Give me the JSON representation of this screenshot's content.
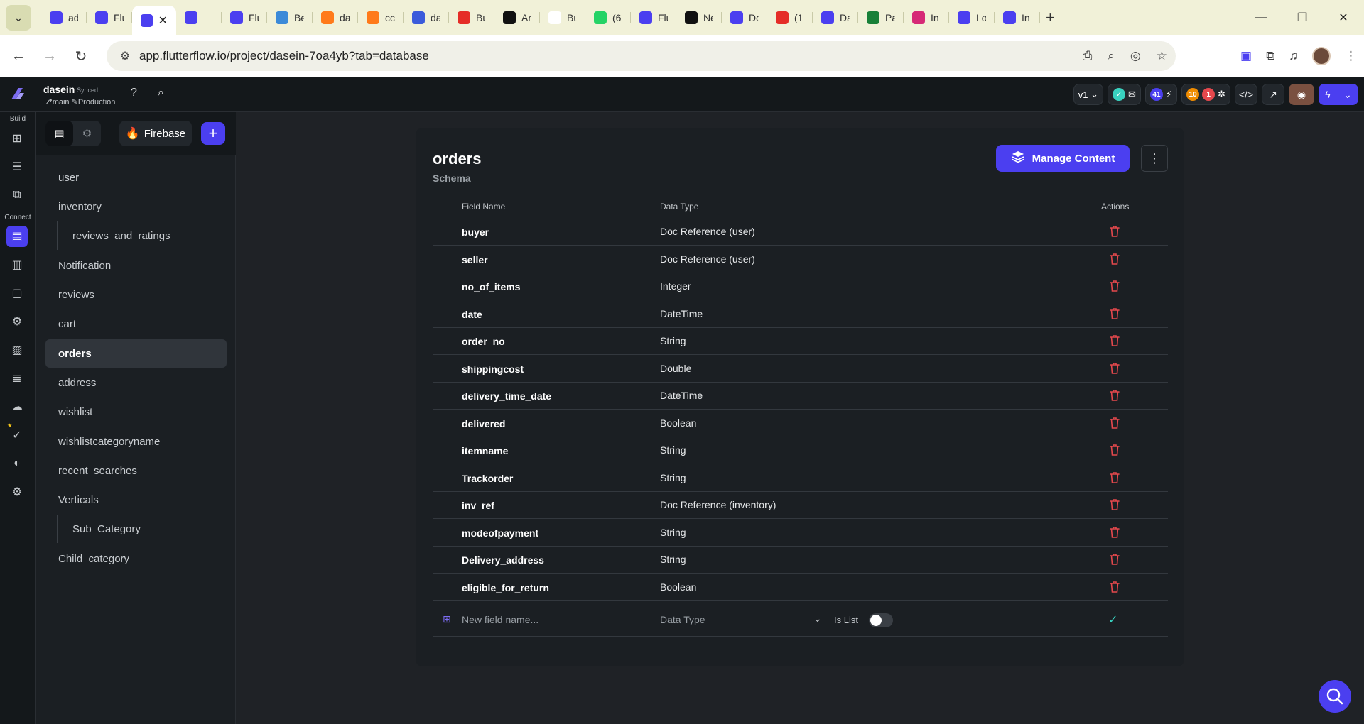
{
  "browser": {
    "tabs": [
      {
        "icon": "flutterflow-icon",
        "title": "ad",
        "color": "#4b3ff0"
      },
      {
        "icon": "flutterflow-icon",
        "title": "Flu",
        "color": "#4b3ff0"
      },
      {
        "icon": "flutterflow-icon",
        "title": "",
        "color": "#4b3ff0",
        "active": true
      },
      {
        "icon": "flutterflow-icon",
        "title": "",
        "color": "#4b3ff0"
      },
      {
        "icon": "flutterflow-icon",
        "title": "Flu",
        "color": "#4b3ff0"
      },
      {
        "icon": "app-icon",
        "title": "Be",
        "color": "#3c8ad8"
      },
      {
        "icon": "firebase-icon",
        "title": "da",
        "color": "#ff7a1a"
      },
      {
        "icon": "firebase-icon",
        "title": "cc",
        "color": "#ff7a1a"
      },
      {
        "icon": "at-icon",
        "title": "da",
        "color": "#3b5bdb"
      },
      {
        "icon": "youtube-icon",
        "title": "Bu",
        "color": "#e52d27"
      },
      {
        "icon": "amazon-icon",
        "title": "Ar",
        "color": "#111111"
      },
      {
        "icon": "amazon-icon",
        "title": "Bu",
        "color": "#ffffff"
      },
      {
        "icon": "whatsapp-icon",
        "title": "(6",
        "color": "#25d366"
      },
      {
        "icon": "flutterflow-icon",
        "title": "Flu",
        "color": "#4b3ff0"
      },
      {
        "icon": "netflix-icon",
        "title": "Ne",
        "color": "#111111"
      },
      {
        "icon": "flutterflow-icon",
        "title": "Do",
        "color": "#4b3ff0"
      },
      {
        "icon": "youtube-icon",
        "title": "(1",
        "color": "#e52d27"
      },
      {
        "icon": "flutterflow-icon",
        "title": "Da",
        "color": "#4b3ff0"
      },
      {
        "icon": "sheets-icon",
        "title": "Pa",
        "color": "#188038"
      },
      {
        "icon": "instagram-icon",
        "title": "In",
        "color": "#d62976"
      },
      {
        "icon": "flutterflow-icon",
        "title": "Lo",
        "color": "#4b3ff0"
      },
      {
        "icon": "flutterflow-icon",
        "title": "In",
        "color": "#4b3ff0"
      }
    ],
    "url": "app.flutterflow.io/project/dasein-7oa4yb?tab=database"
  },
  "app": {
    "project_name": "dasein",
    "sync_status": "Synced",
    "branch": "main",
    "environment": "Production",
    "version": "v1",
    "badge_count_1": "41",
    "badge_count_2": "10",
    "badge_count_3": "1"
  },
  "rail": {
    "build_label": "Build",
    "connect_label": "Connect"
  },
  "collections": {
    "firebase_label": "Firebase",
    "items": [
      {
        "label": "user",
        "sub": false,
        "active": false
      },
      {
        "label": "inventory",
        "sub": false,
        "active": false
      },
      {
        "label": "reviews_and_ratings",
        "sub": true,
        "active": false
      },
      {
        "label": "Notification",
        "sub": false,
        "active": false
      },
      {
        "label": "reviews",
        "sub": false,
        "active": false
      },
      {
        "label": "cart",
        "sub": false,
        "active": false
      },
      {
        "label": "orders",
        "sub": false,
        "active": true
      },
      {
        "label": "address",
        "sub": false,
        "active": false
      },
      {
        "label": "wishlist",
        "sub": false,
        "active": false
      },
      {
        "label": "wishlistcategoryname",
        "sub": false,
        "active": false
      },
      {
        "label": "recent_searches",
        "sub": false,
        "active": false
      },
      {
        "label": "Verticals",
        "sub": false,
        "active": false
      },
      {
        "label": "Sub_Category",
        "sub": true,
        "active": false
      },
      {
        "label": "Child_category",
        "sub": false,
        "active": false
      }
    ]
  },
  "schema": {
    "title": "orders",
    "subtitle": "Schema",
    "manage_label": "Manage Content",
    "headers": {
      "field": "Field Name",
      "type": "Data Type",
      "actions": "Actions"
    },
    "fields": [
      {
        "name": "buyer",
        "type": "Doc Reference (user)"
      },
      {
        "name": "seller",
        "type": "Doc Reference (user)"
      },
      {
        "name": "no_of_items",
        "type": "Integer"
      },
      {
        "name": "date",
        "type": "DateTime"
      },
      {
        "name": "order_no",
        "type": "String"
      },
      {
        "name": "shippingcost",
        "type": "Double"
      },
      {
        "name": "delivery_time_date",
        "type": "DateTime"
      },
      {
        "name": "delivered",
        "type": "Boolean"
      },
      {
        "name": "itemname",
        "type": "String"
      },
      {
        "name": "Trackorder",
        "type": "String"
      },
      {
        "name": "inv_ref",
        "type": "Doc Reference (inventory)"
      },
      {
        "name": "modeofpayment",
        "type": "String"
      },
      {
        "name": "Delivery_address",
        "type": "String"
      },
      {
        "name": "eligible_for_return",
        "type": "Boolean"
      }
    ],
    "new_field_placeholder": "New field name...",
    "data_type_placeholder": "Data Type",
    "is_list_label": "Is List",
    "is_list_on": false
  },
  "colors": {
    "accent": "#4b3ff0",
    "delete": "#e5484d",
    "check": "#39d2c0"
  }
}
